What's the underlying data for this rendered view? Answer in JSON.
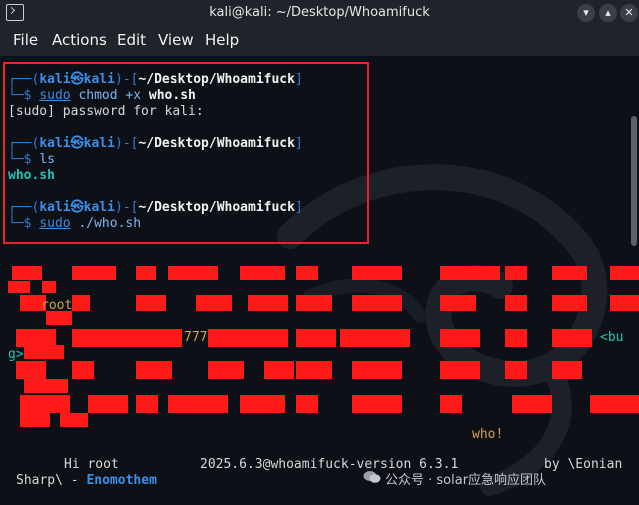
{
  "window": {
    "title": "kali@kali: ~/Desktop/Whoamifuck"
  },
  "menu": {
    "items": [
      "File",
      "Actions",
      "Edit",
      "View",
      "Help"
    ]
  },
  "prompts": [
    {
      "frame_start": "┌──(",
      "user": "kali㉿kali",
      "frame_mid": ")-[",
      "path": "~/Desktop/Whoamifuck",
      "frame_end": "]",
      "arrow": "└─$ ",
      "cmd": "sudo",
      "arg_plain": " chmod +x ",
      "arg_bold": "who.sh"
    },
    {
      "frame_start": "┌──(",
      "user": "kali㉿kali",
      "frame_mid": ")-[",
      "path": "~/Desktop/Whoamifuck",
      "frame_end": "]",
      "arrow": "└─$ ",
      "cmd": "ls",
      "arg_plain": "",
      "arg_bold": ""
    },
    {
      "frame_start": "┌──(",
      "user": "kali㉿kali",
      "frame_mid": ")-[",
      "path": "~/Desktop/Whoamifuck",
      "frame_end": "]",
      "arrow": "└─$ ",
      "cmd": "sudo",
      "arg_plain": " ./who.sh",
      "arg_bold": ""
    }
  ],
  "output": {
    "sudo_password": "[sudo] password for kali:",
    "ls_result": "who.sh"
  },
  "banner": {
    "root_label": "root",
    "num_label": "777",
    "bu_label": "<bu",
    "g_label": "g>",
    "who_label": "who!"
  },
  "info": {
    "greeting": "Hi root",
    "version": "2025.6.3@whoamifuck-version 6.3.1",
    "author_prefix": "by \\Eonian",
    "sharp": "Sharp\\ - ",
    "team": "Enomothem"
  },
  "watermark": {
    "text": "公众号 · solar应急响应团队"
  },
  "colors": {
    "frame": "#2f7fd0",
    "user": "#3b8eea",
    "file": "#21c3b6",
    "banner_red": "#ff1a1a",
    "highlight": "#e8242b",
    "orange": "#d7a050"
  }
}
